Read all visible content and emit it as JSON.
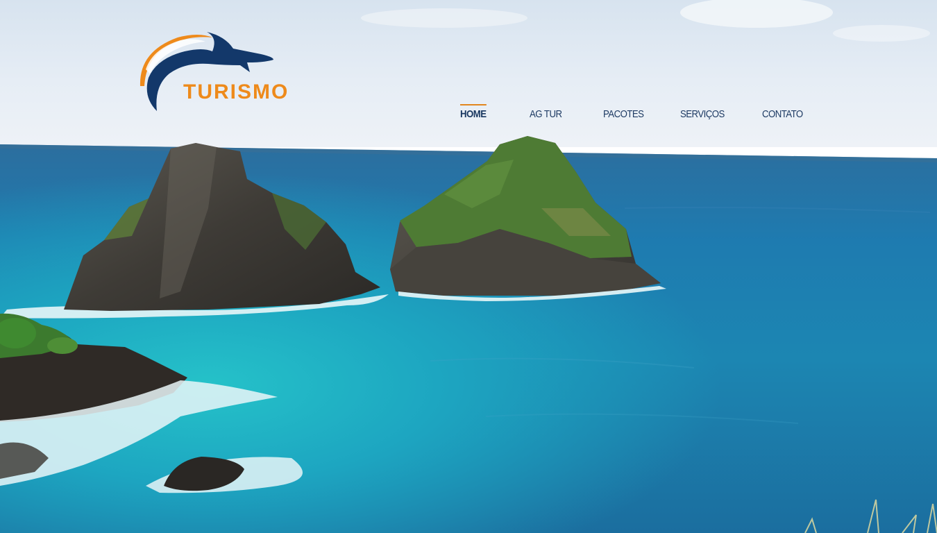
{
  "brand": {
    "name": "TURISMO",
    "logo_icon": "dolphin-swoosh-icon",
    "colors": {
      "orange": "#EE8A1B",
      "navy": "#13386A"
    }
  },
  "nav": {
    "items": [
      {
        "label": "HOME",
        "active": true
      },
      {
        "label": "AG TUR",
        "active": false
      },
      {
        "label": "PACOTES",
        "active": false
      },
      {
        "label": "SERVIÇOS",
        "active": false
      },
      {
        "label": "CONTATO",
        "active": false
      }
    ],
    "colors": {
      "text": "#1D3A63",
      "active_underline": "#E2861E"
    }
  },
  "hero": {
    "subject": "ocean-rocks-photo",
    "colors": {
      "sky": "#E4ECF4",
      "sea_deep": "#1E6FA6",
      "sea_turquoise": "#1FA5BE"
    }
  }
}
